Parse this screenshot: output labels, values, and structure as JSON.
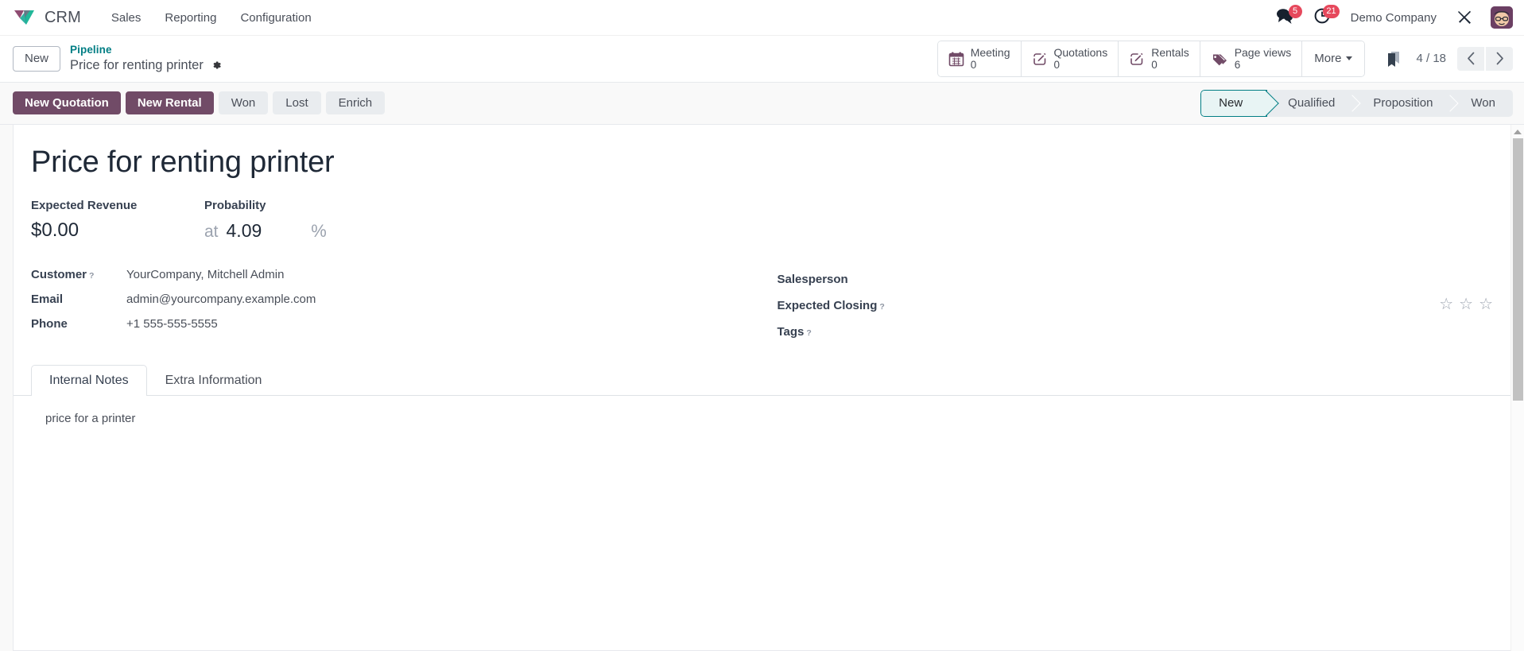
{
  "navbar": {
    "brand_icon": "odoo-logo-icon",
    "app_name": "CRM",
    "menu_items": [
      {
        "label": "Sales",
        "name": "menu-sales"
      },
      {
        "label": "Reporting",
        "name": "menu-reporting"
      },
      {
        "label": "Configuration",
        "name": "menu-configuration"
      }
    ],
    "systray": {
      "messages_icon": "messages-icon",
      "messages_count": "5",
      "activities_icon": "clock-activities-icon",
      "activities_count": "21",
      "company": "Demo Company",
      "debug_icon": "wrench-screwdriver-icon",
      "avatar_icon": "user-avatar"
    }
  },
  "control_panel": {
    "new_button": "New",
    "breadcrumb_parent": "Pipeline",
    "breadcrumb_current": "Price for renting printer",
    "settings_icon": "gear-icon",
    "stat_buttons": [
      {
        "label": "Meeting",
        "value": "0",
        "icon": "calendar-icon",
        "name": "stat-button-meeting"
      },
      {
        "label": "Quotations",
        "value": "0",
        "icon": "pencil-square-icon",
        "name": "stat-button-quotations"
      },
      {
        "label": "Rentals",
        "value": "0",
        "icon": "pencil-square-icon",
        "name": "stat-button-rentals"
      },
      {
        "label": "Page views",
        "value": "6",
        "icon": "tags-icon",
        "name": "stat-button-page-views"
      }
    ],
    "more_button": "More",
    "bookmark_icon": "bookmark-icon",
    "pager": "4 / 18",
    "pager_prev_icon": "chevron-left-icon",
    "pager_next_icon": "chevron-right-icon"
  },
  "statusbar": {
    "actions": [
      {
        "label": "New Quotation",
        "style": "primary",
        "name": "new-quotation-button"
      },
      {
        "label": "New Rental",
        "style": "primary",
        "name": "new-rental-button"
      },
      {
        "label": "Won",
        "style": "secondary",
        "name": "won-button"
      },
      {
        "label": "Lost",
        "style": "secondary",
        "name": "lost-button"
      },
      {
        "label": "Enrich",
        "style": "secondary",
        "name": "enrich-button"
      }
    ],
    "stages": [
      {
        "label": "New",
        "active": true
      },
      {
        "label": "Qualified",
        "active": false
      },
      {
        "label": "Proposition",
        "active": false
      },
      {
        "label": "Won",
        "active": false
      }
    ]
  },
  "form": {
    "title": "Price for renting printer",
    "expected_revenue_label": "Expected Revenue",
    "expected_revenue_value": "$0.00",
    "probability_label": "Probability",
    "probability_at": "at",
    "probability_value": "4.09",
    "probability_percent": "%",
    "fields_left": [
      {
        "label": "Customer",
        "help": "?",
        "value": "YourCompany, Mitchell Admin",
        "name": "field-customer"
      },
      {
        "label": "Email",
        "help": "",
        "value": "admin@yourcompany.example.com",
        "name": "field-email"
      },
      {
        "label": "Phone",
        "help": "",
        "value": "+1 555-555-5555",
        "name": "field-phone"
      }
    ],
    "fields_right": [
      {
        "label": "Salesperson",
        "help": "",
        "value": "",
        "name": "field-salesperson"
      },
      {
        "label": "Expected Closing",
        "help": "?",
        "value": "",
        "name": "field-expected-closing"
      },
      {
        "label": "Tags",
        "help": "?",
        "value": "",
        "name": "field-tags"
      }
    ],
    "priority_stars": [
      "☆",
      "☆",
      "☆"
    ],
    "tabs": [
      {
        "label": "Internal Notes",
        "active": true,
        "name": "tab-internal-notes"
      },
      {
        "label": "Extra Information",
        "active": false,
        "name": "tab-extra-information"
      }
    ],
    "notes_content": "price for a printer"
  },
  "colors": {
    "brand_purple": "#714b67",
    "accent_teal": "#017e84",
    "badge_red": "#e6485c",
    "secondary_grey": "#e9ecef"
  }
}
